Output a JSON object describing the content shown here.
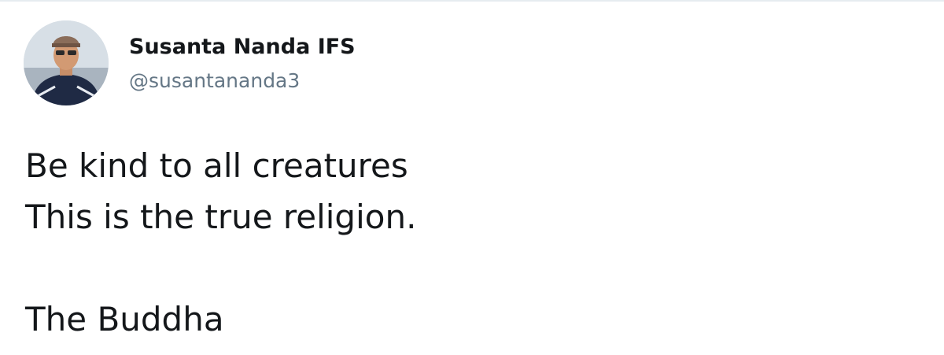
{
  "author": {
    "display_name": "Susanta Nanda IFS",
    "handle": "@susantananda3"
  },
  "tweet": {
    "line_1": "Be kind to all creatures",
    "line_2": "This is the true religion.",
    "line_3": "The Buddha"
  },
  "colors": {
    "background": "#ffffff",
    "border": "#e6ecf0",
    "name_text": "#14171a",
    "handle_text": "#657786",
    "body_text": "#14171a"
  }
}
